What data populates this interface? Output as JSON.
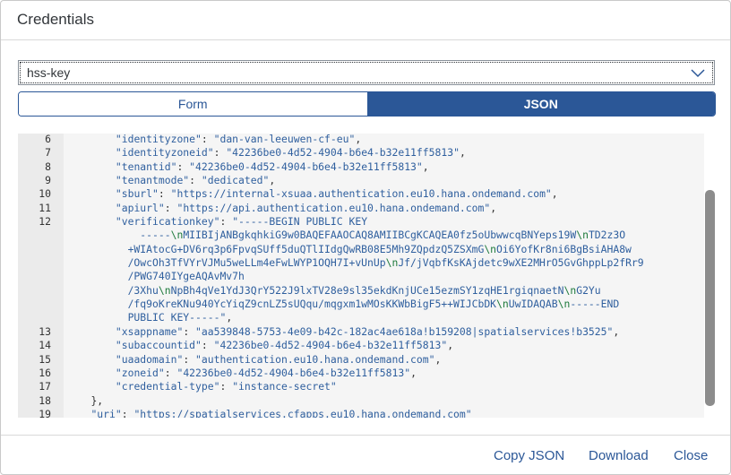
{
  "dialog": {
    "title": "Credentials"
  },
  "key_select": {
    "value": "hss-key"
  },
  "view_toggle": {
    "form_label": "Form",
    "json_label": "JSON",
    "selected": "JSON"
  },
  "code": {
    "lines": [
      {
        "n": "6",
        "html": "        <span class=\"k\">\"identityzone\"</span><span class=\"p\">: </span><span class=\"s\">\"dan-van-leeuwen-cf-eu\"</span><span class=\"p\">,</span>"
      },
      {
        "n": "7",
        "html": "        <span class=\"k\">\"identityzoneid\"</span><span class=\"p\">: </span><span class=\"s\">\"42236be0-4d52-4904-b6e4-b32e11ff5813\"</span><span class=\"p\">,</span>"
      },
      {
        "n": "8",
        "html": "        <span class=\"k\">\"tenantid\"</span><span class=\"p\">: </span><span class=\"s\">\"42236be0-4d52-4904-b6e4-b32e11ff5813\"</span><span class=\"p\">,</span>"
      },
      {
        "n": "9",
        "html": "        <span class=\"k\">\"tenantmode\"</span><span class=\"p\">: </span><span class=\"s\">\"dedicated\"</span><span class=\"p\">,</span>"
      },
      {
        "n": "10",
        "html": "        <span class=\"k\">\"sburl\"</span><span class=\"p\">: </span><span class=\"s\">\"https://internal-xsuaa.authentication.eu10.hana.ondemand.com\"</span><span class=\"p\">,</span>"
      },
      {
        "n": "11",
        "html": "        <span class=\"k\">\"apiurl\"</span><span class=\"p\">: </span><span class=\"s\">\"https://api.authentication.eu10.hana.ondemand.com\"</span><span class=\"p\">,</span>"
      },
      {
        "n": "12",
        "html": "        <span class=\"k\">\"verificationkey\"</span><span class=\"p\">: </span><span class=\"s\">\"-----BEGIN PUBLIC KEY</span>"
      },
      {
        "n": "",
        "html": "            <span class=\"s\">-----</span><span class=\"esc\">\\n</span><span class=\"s\">MIIBIjANBgkqhkiG9w0BAQEFAAOCAQ8AMIIBCgKCAQEA0fz5oUbwwcqBNYeps19W</span><span class=\"esc\">\\n</span><span class=\"s\">TD2z3O</span>"
      },
      {
        "n": "",
        "html": "          <span class=\"s\">+WIAtocG+DV6rq3p6FpvqSUff5duQTlIIdgQwRB08E5Mh9ZQpdzQ5ZSXmG</span><span class=\"esc\">\\n</span><span class=\"s\">Oi6YofKr8ni6BgBsiAHA8w</span>"
      },
      {
        "n": "",
        "html": "          <span class=\"s\">/OwcOh3TfVYrVJMu5weLLm4eFwLWYP1OQH7I+vUnUp</span><span class=\"esc\">\\n</span><span class=\"s\">Jf/jVqbfKsKAjdetc9wXE2MHrO5GvGhppLp2fRr9</span>"
      },
      {
        "n": "",
        "html": "          <span class=\"s\">/PWG740IYgeAQAvMv7h</span>"
      },
      {
        "n": "",
        "html": "          <span class=\"s\">/3Xhu</span><span class=\"esc\">\\n</span><span class=\"s\">NpBh4qVe1YdJ3QrY522J9lxTV28e9sl35ekdKnjUCe15ezmSY1zqHE1rgiqnaetN</span><span class=\"esc\">\\n</span><span class=\"s\">G2Yu</span>"
      },
      {
        "n": "",
        "html": "          <span class=\"s\">/fq9oKreKNu940YcYiqZ9cnLZ5sUQqu/mqgxm1wMOsKKWbBigF5++WIJCbDK</span><span class=\"esc\">\\n</span><span class=\"s\">UwIDAQAB</span><span class=\"esc\">\\n</span><span class=\"s\">-----END</span>"
      },
      {
        "n": "",
        "html": "          <span class=\"s\">PUBLIC KEY-----\"</span><span class=\"p\">,</span>"
      },
      {
        "n": "13",
        "html": "        <span class=\"k\">\"xsappname\"</span><span class=\"p\">: </span><span class=\"s\">\"aa539848-5753-4e09-b42c-182ac4ae618a!b159208|spatialservices!b3525\"</span><span class=\"p\">,</span>"
      },
      {
        "n": "14",
        "html": "        <span class=\"k\">\"subaccountid\"</span><span class=\"p\">: </span><span class=\"s\">\"42236be0-4d52-4904-b6e4-b32e11ff5813\"</span><span class=\"p\">,</span>"
      },
      {
        "n": "15",
        "html": "        <span class=\"k\">\"uaadomain\"</span><span class=\"p\">: </span><span class=\"s\">\"authentication.eu10.hana.ondemand.com\"</span><span class=\"p\">,</span>"
      },
      {
        "n": "16",
        "html": "        <span class=\"k\">\"zoneid\"</span><span class=\"p\">: </span><span class=\"s\">\"42236be0-4d52-4904-b6e4-b32e11ff5813\"</span><span class=\"p\">,</span>"
      },
      {
        "n": "17",
        "html": "        <span class=\"k\">\"credential-type\"</span><span class=\"p\">: </span><span class=\"s\">\"instance-secret\"</span>"
      },
      {
        "n": "18",
        "html": "    <span class=\"p\">},</span>"
      },
      {
        "n": "19",
        "html": "    <span class=\"k\">\"uri\"</span><span class=\"p\">: </span><span class=\"s\">\"https://spatialservices.cfapps.eu10.hana.ondemand.com\"</span>"
      }
    ]
  },
  "footer": {
    "copy_label": "Copy JSON",
    "download_label": "Download",
    "close_label": "Close"
  },
  "colors": {
    "accent": "#2b5797",
    "editor_bg": "#f5f5f5",
    "gutter_bg": "#ebebeb"
  },
  "icons": {
    "select_arrow": "chevron-down-icon"
  }
}
